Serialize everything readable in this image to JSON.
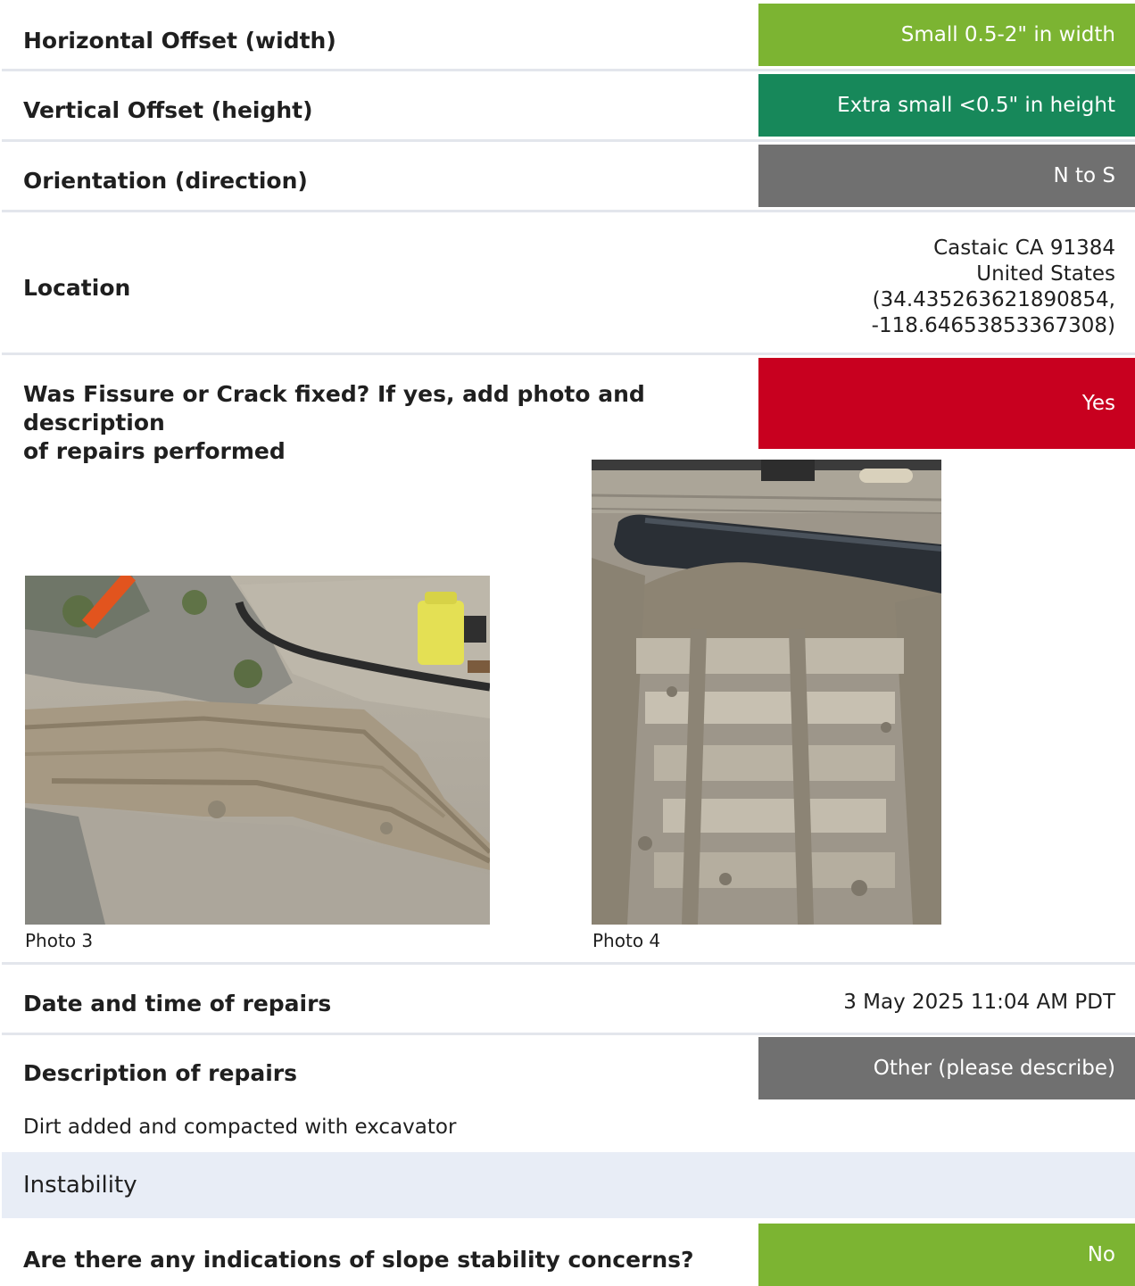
{
  "fields": {
    "horizontal_offset": {
      "label": "Horizontal Offset (width)",
      "value": "Small 0.5-2\" in width",
      "color": "#7cb432"
    },
    "vertical_offset": {
      "label": "Vertical Offset (height)",
      "value": "Extra small <0.5\" in height",
      "color": "#17885a"
    },
    "orientation": {
      "label": "Orientation (direction)",
      "value": "N to S",
      "color": "#707070"
    },
    "location": {
      "label": "Location",
      "line1": "Castaic CA 91384",
      "line2": "United States",
      "line3": "(34.435263621890854,",
      "line4": "-118.64653853367308)"
    },
    "fixed": {
      "label_line1": "Was Fissure or Crack fixed? If yes, add photo and description",
      "label_line2": "of repairs performed",
      "value": "Yes",
      "color": "#c8001f"
    },
    "photos": [
      {
        "caption": "Photo 3"
      },
      {
        "caption": "Photo 4"
      }
    ],
    "repair_date": {
      "label": "Date and time of repairs",
      "value": "3 May 2025 11:04 AM PDT"
    },
    "repair_description": {
      "label": "Description of repairs",
      "value": "Other (please describe)",
      "color": "#707070"
    },
    "repair_notes": "Dirt added and compacted with excavator"
  },
  "instability": {
    "section_title": "Instability",
    "slope_concerns": {
      "label": "Are there any indications of slope stability concerns?",
      "value": "No",
      "color": "#7cb432"
    }
  }
}
